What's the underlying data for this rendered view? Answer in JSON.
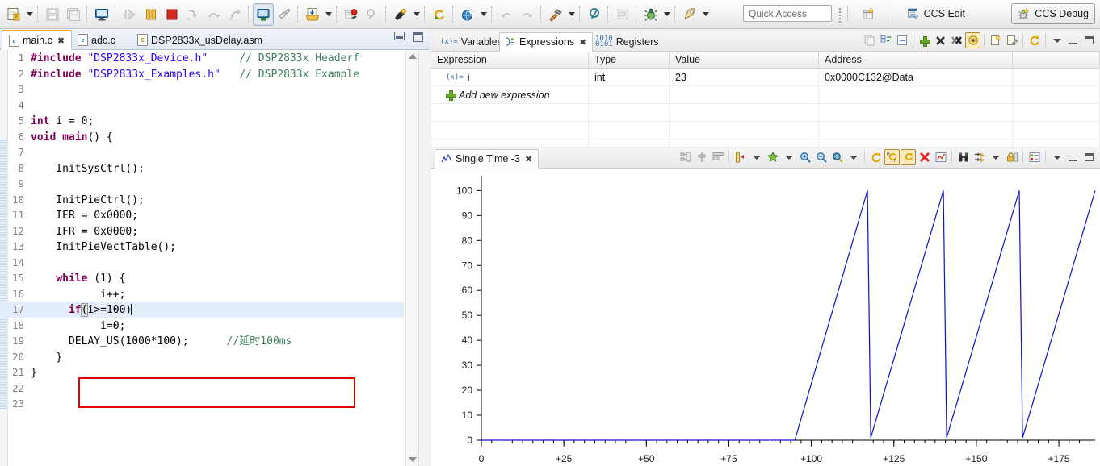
{
  "toolbar": {
    "items": [
      {
        "name": "new-file-button",
        "label": "New"
      },
      {
        "name": "new-file-dropdown",
        "label": "New options"
      },
      {
        "name": "save-button",
        "label": "Save"
      },
      {
        "name": "save-all-button",
        "label": "Save All"
      },
      {
        "name": "console-button",
        "label": "Console"
      },
      {
        "name": "resume-button",
        "label": "Resume"
      },
      {
        "name": "suspend-button",
        "label": "Suspend"
      },
      {
        "name": "terminate-button",
        "label": "Terminate"
      },
      {
        "name": "step-into-button",
        "label": "Step Into"
      },
      {
        "name": "step-over-button",
        "label": "Step Over"
      },
      {
        "name": "step-return-button",
        "label": "Step Return"
      },
      {
        "name": "connect-target-button",
        "label": "Connect Target"
      },
      {
        "name": "disconnect-target-button",
        "label": "Disconnect Target"
      },
      {
        "name": "load-program-button",
        "label": "Load Program"
      },
      {
        "name": "load-program-dropdown",
        "label": "Load Program options"
      },
      {
        "name": "breakpoint-button",
        "label": "Toggle Breakpoint"
      },
      {
        "name": "remove-breakpoints-button",
        "label": "Remove All Breakpoints"
      },
      {
        "name": "tools-button",
        "label": "Tools"
      },
      {
        "name": "tools-dropdown",
        "label": "Tools options"
      },
      {
        "name": "restart-button",
        "label": "Restart"
      },
      {
        "name": "debug-launch-button",
        "label": "Debug"
      },
      {
        "name": "debug-launch-dropdown",
        "label": "Debug options"
      },
      {
        "name": "refresh-button",
        "label": "Refresh"
      },
      {
        "name": "undo-button",
        "label": "Undo"
      },
      {
        "name": "build-button",
        "label": "Build"
      },
      {
        "name": "build-dropdown",
        "label": "Build options"
      },
      {
        "name": "search-button",
        "label": "Search"
      },
      {
        "name": "new-window-button",
        "label": "New Window"
      },
      {
        "name": "debug-bug-button",
        "label": "Debug"
      },
      {
        "name": "debug-bug-dropdown",
        "label": "Debug configurations"
      },
      {
        "name": "run-button",
        "label": "Run"
      },
      {
        "name": "run-dropdown",
        "label": "Run configurations"
      }
    ],
    "quick_access": {
      "placeholder": "Quick Access",
      "value": "Quick Access"
    },
    "perspective": {
      "open_label": "Open Perspective",
      "edit_label": "CCS Edit",
      "debug_label": "CCS Debug"
    }
  },
  "editor": {
    "tabs": [
      {
        "label": "main.c",
        "icon": "c-file-icon",
        "badge": "c",
        "active": true,
        "closable": true
      },
      {
        "label": "adc.c",
        "icon": "c-file-icon",
        "badge": "c",
        "active": false,
        "closable": false
      },
      {
        "label": "DSP2833x_usDelay.asm",
        "icon": "asm-file-icon",
        "badge": "S",
        "active": false,
        "closable": false
      }
    ],
    "window_buttons": [
      "minimize",
      "maximize"
    ],
    "code_lines": [
      {
        "n": "1",
        "tokens": [
          {
            "t": "kw",
            "v": "#include"
          },
          {
            "t": "pl",
            "v": " "
          },
          {
            "t": "str",
            "v": "\"DSP2833x_Device.h\""
          },
          {
            "t": "pl",
            "v": "     "
          },
          {
            "t": "cmt",
            "v": "// DSP2833x Headerf"
          }
        ]
      },
      {
        "n": "2",
        "tokens": [
          {
            "t": "kw",
            "v": "#include"
          },
          {
            "t": "pl",
            "v": " "
          },
          {
            "t": "str",
            "v": "\"DSP2833x_Examples.h\""
          },
          {
            "t": "pl",
            "v": "   "
          },
          {
            "t": "cmt",
            "v": "// DSP2833x Example"
          }
        ]
      },
      {
        "n": "3",
        "tokens": []
      },
      {
        "n": "4",
        "tokens": []
      },
      {
        "n": "5",
        "tokens": [
          {
            "t": "kw",
            "v": "int"
          },
          {
            "t": "pl",
            "v": " i = 0;"
          }
        ]
      },
      {
        "n": "6",
        "tokens": [
          {
            "t": "kw",
            "v": "void"
          },
          {
            "t": "pl",
            "v": " "
          },
          {
            "t": "kw",
            "v": "main"
          },
          {
            "t": "pl",
            "v": "() {"
          }
        ]
      },
      {
        "n": "7",
        "tokens": []
      },
      {
        "n": "8",
        "tokens": [
          {
            "t": "pl",
            "v": "    InitSysCtrl();"
          }
        ]
      },
      {
        "n": "9",
        "tokens": []
      },
      {
        "n": "10",
        "tokens": [
          {
            "t": "pl",
            "v": "    InitPieCtrl();"
          }
        ]
      },
      {
        "n": "11",
        "tokens": [
          {
            "t": "pl",
            "v": "    IER = 0x0000;"
          }
        ]
      },
      {
        "n": "12",
        "tokens": [
          {
            "t": "pl",
            "v": "    IFR = 0x0000;"
          }
        ]
      },
      {
        "n": "13",
        "tokens": [
          {
            "t": "pl",
            "v": "    InitPieVectTable();"
          }
        ]
      },
      {
        "n": "14",
        "tokens": []
      },
      {
        "n": "15",
        "tokens": [
          {
            "t": "pl",
            "v": "    "
          },
          {
            "t": "kw",
            "v": "while"
          },
          {
            "t": "pl",
            "v": " (1) {"
          }
        ]
      },
      {
        "n": "16",
        "tokens": [
          {
            "t": "pl",
            "v": "           i++;"
          }
        ]
      },
      {
        "n": "17",
        "tokens": [
          {
            "t": "pl",
            "v": "      "
          },
          {
            "t": "kw",
            "v": "if"
          },
          {
            "t": "brbox",
            "v": "("
          },
          {
            "t": "pl",
            "v": "i>=100)"
          },
          {
            "t": "caret",
            "v": ""
          }
        ],
        "highlight": true
      },
      {
        "n": "18",
        "tokens": [
          {
            "t": "pl",
            "v": "           i=0;"
          }
        ]
      },
      {
        "n": "19",
        "tokens": [
          {
            "t": "pl",
            "v": "      DELAY_US(1000*100);      "
          },
          {
            "t": "cmt",
            "v": "//延时100ms"
          }
        ]
      },
      {
        "n": "20",
        "tokens": [
          {
            "t": "pl",
            "v": "    }"
          }
        ]
      },
      {
        "n": "21",
        "tokens": [
          {
            "t": "pl",
            "v": "}"
          }
        ]
      },
      {
        "n": "22",
        "tokens": []
      },
      {
        "n": "23",
        "tokens": []
      }
    ],
    "annotation_box": {
      "name": "red-highlight-box",
      "color": "#e00000"
    }
  },
  "expressions": {
    "tabs": [
      {
        "label": "Variables",
        "icon": "variables-icon",
        "active": false,
        "closable": false
      },
      {
        "label": "Expressions",
        "icon": "expressions-icon",
        "active": true,
        "closable": true
      },
      {
        "label": "Registers",
        "icon": "registers-icon",
        "active": false,
        "closable": false
      }
    ],
    "tools": [
      {
        "name": "copy-expressions-button"
      },
      {
        "name": "expand-all-button"
      },
      {
        "name": "collapse-all-button"
      },
      {
        "name": "add-expression-button"
      },
      {
        "name": "remove-expression-button"
      },
      {
        "name": "remove-all-expressions-button"
      },
      {
        "name": "enable-watch-button",
        "active": true
      },
      {
        "name": "new-watchpoint-button"
      },
      {
        "name": "edit-watchpoint-button"
      },
      {
        "name": "refresh-view-button"
      }
    ],
    "columns": [
      "Expression",
      "Type",
      "Value",
      "Address",
      ""
    ],
    "rows": [
      {
        "expression": "i",
        "type": "int",
        "value": "23",
        "address": "0x0000C132@Data",
        "extra": ""
      }
    ],
    "add_new_label": "Add new expression",
    "empty_rows": 3
  },
  "graph": {
    "tabs": [
      {
        "label": "Single Time -3",
        "icon": "graph-icon",
        "active": true,
        "closable": true
      }
    ],
    "tools": [
      {
        "name": "graph-properties-button"
      },
      {
        "name": "align-center-button"
      },
      {
        "name": "data-properties-button"
      },
      {
        "name": "measurement-marker-button"
      },
      {
        "name": "measurement-marker-dropdown"
      },
      {
        "name": "add-marker-button"
      },
      {
        "name": "add-marker-dropdown"
      },
      {
        "name": "zoom-in-button"
      },
      {
        "name": "zoom-out-button"
      },
      {
        "name": "zoom-reset-button"
      },
      {
        "name": "zoom-reset-dropdown"
      },
      {
        "name": "refresh-graph-button"
      },
      {
        "name": "continuous-refresh-button",
        "active": true
      },
      {
        "name": "auto-refresh-button",
        "active": true
      },
      {
        "name": "clear-data-button"
      },
      {
        "name": "export-data-button"
      },
      {
        "name": "search-data-button"
      },
      {
        "name": "scroll-lock-button"
      },
      {
        "name": "scroll-lock-dropdown"
      },
      {
        "name": "lock-graph-button"
      },
      {
        "name": "legend-button"
      }
    ]
  },
  "chart_data": {
    "type": "line",
    "title": "Single Time -3",
    "xlabel": "",
    "ylabel": "",
    "xlim": [
      0,
      186
    ],
    "ylim": [
      0,
      104
    ],
    "xticks": [
      0,
      25,
      50,
      75,
      100,
      125,
      150,
      175
    ],
    "xticklabels": [
      "0",
      "+25",
      "+50",
      "+75",
      "+100",
      "+125",
      "+150",
      "+175"
    ],
    "yticks": [
      0,
      10,
      20,
      30,
      40,
      50,
      60,
      70,
      80,
      90,
      100
    ],
    "yticklabels": [
      "0",
      "10",
      "20",
      "30",
      "40",
      "50",
      "60",
      "70",
      "80",
      "90",
      "100"
    ],
    "grid": false,
    "legend": null,
    "series": [
      {
        "name": "i",
        "color": "#1010cf",
        "description": "Sawtooth ramp 0..100 counter reset at 100, flat zero until x=+95",
        "points": [
          [
            0,
            0
          ],
          [
            95,
            0
          ],
          [
            117,
            100
          ],
          [
            118,
            1
          ],
          [
            140,
            100
          ],
          [
            141,
            1
          ],
          [
            163,
            100
          ],
          [
            164,
            1
          ],
          [
            186,
            100
          ]
        ]
      }
    ]
  }
}
